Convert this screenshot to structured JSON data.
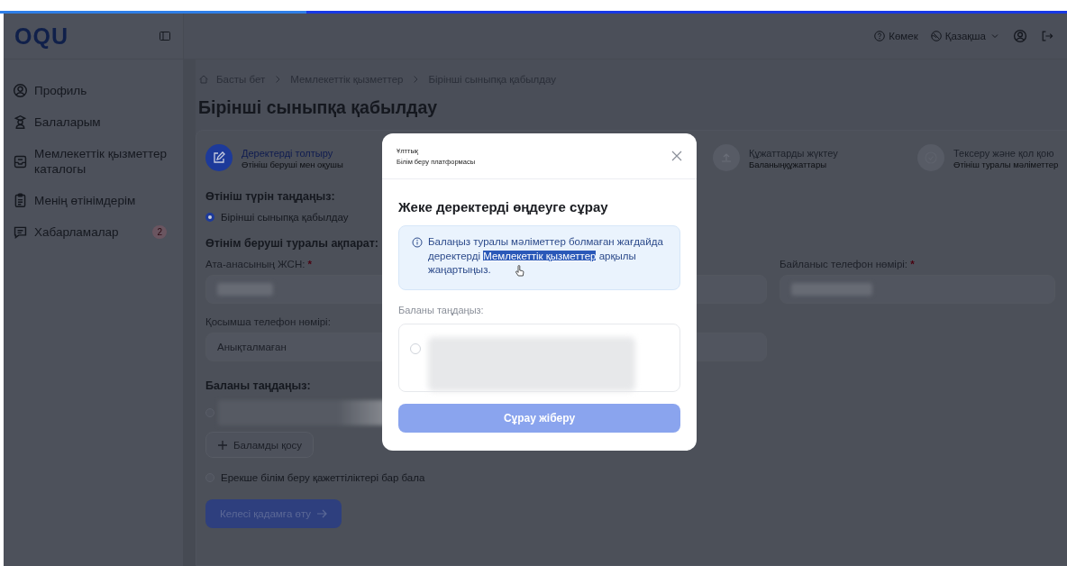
{
  "logo": "OQU",
  "header": {
    "help": "Көмек",
    "language": "Қазақша"
  },
  "sidebar": {
    "items": [
      {
        "label": "Профиль"
      },
      {
        "label": "Балаларым"
      },
      {
        "label": "Мемлекеттік қызметтер каталогы"
      },
      {
        "label": "Менің өтінімдерім"
      },
      {
        "label": "Хабарламалар",
        "badge": "2"
      }
    ]
  },
  "breadcrumb": [
    "Басты бет",
    "Мемлекеттік қызметтер",
    "Бірінші сыныпқа қабылдау"
  ],
  "page_title": "Бірінші сыныпқа қабылдау",
  "steps": [
    {
      "title": "Деректерді толтыру",
      "subtitle": "Өтініш беруші мен оқушы",
      "selected": true
    },
    {
      "title": "Құжаттарды жүктеу",
      "subtitle": "Баланыңқұжаттары",
      "selected": false
    },
    {
      "title": "Тексеру және қол қою",
      "subtitle": "Өтініш туралы мәліметтер",
      "selected": false
    }
  ],
  "form": {
    "type_label": "Өтініш түрін таңдаңыз:",
    "type_options": [
      {
        "label": "Бірінші сыныпқа қабылдау",
        "selected": true
      }
    ],
    "applicant_label": "Өтінім беруші туралы ақпарат:",
    "iin_label": "Ата-анасының ЖСН:",
    "phone_label": "Байланыс телефон нөмірі:",
    "required_mark": "*",
    "extra_phone_label": "Қосымша телефон нөмірі:",
    "extra_phone_value": "Анықталмаған",
    "child_label": "Баланы таңдаңыз:",
    "child_selected": false,
    "add_child": "Баламды қосу",
    "special_needs": {
      "label": "Ерекше білім беру қажеттіліктері бар бала",
      "checked": false
    },
    "next": "Келесі қадамға өту"
  },
  "modal": {
    "brand_top": "Ұлттық",
    "brand_bottom": "Білім беру платформасы",
    "title": "Жеке деректерді өңдеуге сұрау",
    "info_before": "Балаңыз туралы мәліметтер болмаған жағдайда деректерді ",
    "info_link": "Мемлекеттік қызметтер",
    "info_after": " арқылы жаңартыңыз.",
    "child_label": "Баланы таңдаңыз:",
    "child_selected": false,
    "submit": "Сұрау жіберу"
  }
}
